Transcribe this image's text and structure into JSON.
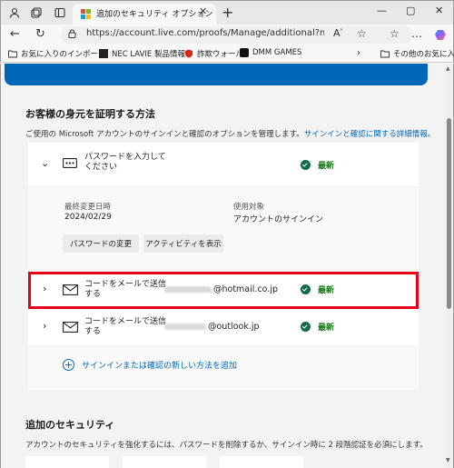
{
  "browser": {
    "tab_title": "追加のセキュリティ オプション",
    "url": "https://account.live.com/proofs/Manage/additional?mkt=ja-jp&...",
    "bookmarks": [
      "お気に入りのインポート",
      "NEC LAVIE 製品情報",
      "詐欺ウォール",
      "DMM GAMES"
    ],
    "other_favorites": "その他のお気に入り"
  },
  "identity": {
    "title": "お客様の身元を証明する方法",
    "description": "ご使用の Microsoft アカウントのサインインと確認のオプションを管理します。",
    "learn_more": "サインインと確認に関する詳細情報。",
    "password": {
      "label_line1": "パスワードを入力して",
      "label_line2": "ください",
      "status": "最新",
      "last_changed_label": "最終変更日時",
      "last_changed_value": "2024/02/29",
      "usage_label": "使用対象",
      "usage_value": "アカウントのサインイン",
      "change_button": "パスワードの変更",
      "activity_button": "アクティビティを表示"
    },
    "methods": [
      {
        "line1": "コードをメールで送信",
        "line2": "する",
        "email_suffix": "@hotmail.co.jp",
        "status": "最新"
      },
      {
        "line1": "コードをメールで送信",
        "line2": "する",
        "email_suffix": "@outlook.jp",
        "status": "最新"
      }
    ],
    "add_method": "サインインまたは確認の新しい方法を追加"
  },
  "security": {
    "title": "追加のセキュリティ",
    "description": "アカウントのセキュリティを強化するには、パスワードを削除するか、サインイン時に 2 段階認証を必須にします。"
  },
  "colors": {
    "accent": "#0067b8",
    "status_green": "#107c10",
    "highlight_red": "#e6001a"
  }
}
